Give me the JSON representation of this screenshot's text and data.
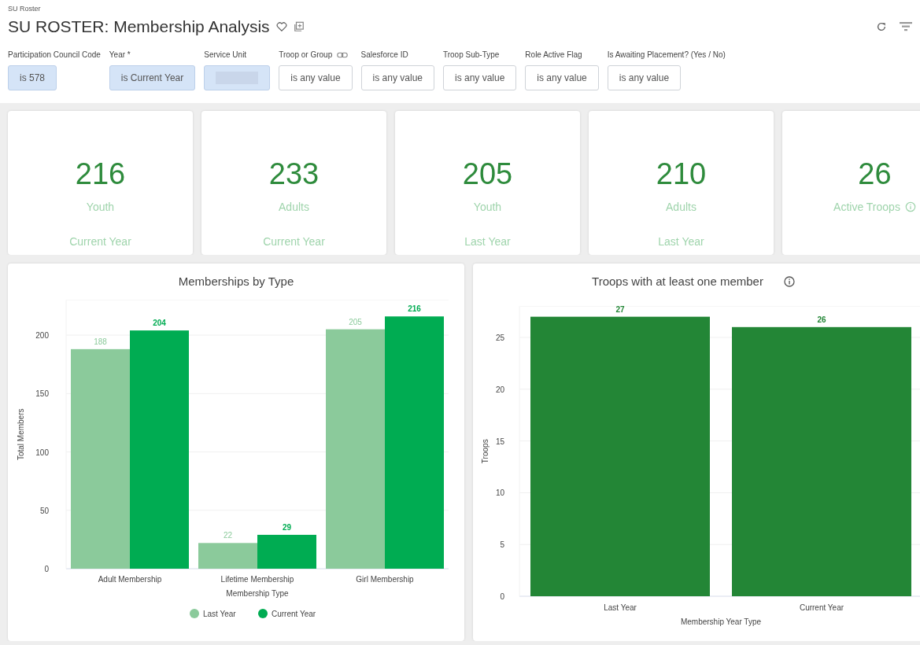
{
  "breadcrumb": "SU Roster",
  "title": "SU ROSTER: Membership Analysis",
  "filters": [
    {
      "label": "Participation Council Code",
      "value": "is 578",
      "set": true
    },
    {
      "label": "Year *",
      "value": "is Current Year",
      "set": true
    },
    {
      "label": "Service Unit",
      "set": true
    },
    {
      "label": "Troop or Group",
      "value": "is any value",
      "set": false,
      "linked": true
    },
    {
      "label": "Salesforce ID",
      "value": "is any value",
      "set": false
    },
    {
      "label": "Troop Sub-Type",
      "value": "is any value",
      "set": false
    },
    {
      "label": "Role Active Flag",
      "value": "is any value",
      "set": false
    },
    {
      "label": "Is Awaiting Placement? (Yes / No)",
      "value": "is any value",
      "set": false
    }
  ],
  "tiles": [
    {
      "value": "216",
      "label": "Youth",
      "period": "Current Year"
    },
    {
      "value": "233",
      "label": "Adults",
      "period": "Current Year"
    },
    {
      "value": "205",
      "label": "Youth",
      "period": "Last Year"
    },
    {
      "value": "210",
      "label": "Adults",
      "period": "Last Year"
    },
    {
      "value": "26",
      "label": "Active Troops",
      "info": true
    }
  ],
  "charts": [
    {
      "title": "Memberships by Type",
      "chart_data": {
        "type": "bar",
        "xlabel": "Membership Type",
        "ylabel": "Total Members",
        "categories": [
          "Adult Membership",
          "Lifetime Membership",
          "Girl Membership"
        ],
        "series": [
          {
            "name": "Last Year",
            "color": "#8bca9b",
            "values": [
              188,
              22,
              205
            ],
            "value_labels": [
              "188",
              "22",
              "205"
            ]
          },
          {
            "name": "Current Year",
            "color": "#00ac52",
            "values": [
              204,
              29,
              216
            ],
            "value_labels": [
              "204",
              "29",
              "216"
            ]
          }
        ],
        "ylim": [
          0,
          230
        ],
        "yticks": [
          0,
          50,
          100,
          150,
          200
        ],
        "grid": true,
        "legend": true
      }
    },
    {
      "title": "Troops with at least one member",
      "info": true,
      "chart_data": {
        "type": "bar",
        "xlabel": "Membership Year Type",
        "ylabel": "Troops",
        "categories": [
          "Last Year",
          "Current Year"
        ],
        "series": [
          {
            "color": "#238636",
            "values": [
              27,
              26
            ],
            "value_labels": [
              "27",
              "26"
            ]
          }
        ],
        "ylim": [
          0,
          28
        ],
        "yticks": [
          0,
          5,
          10,
          15,
          20,
          25
        ],
        "grid": true
      }
    }
  ]
}
